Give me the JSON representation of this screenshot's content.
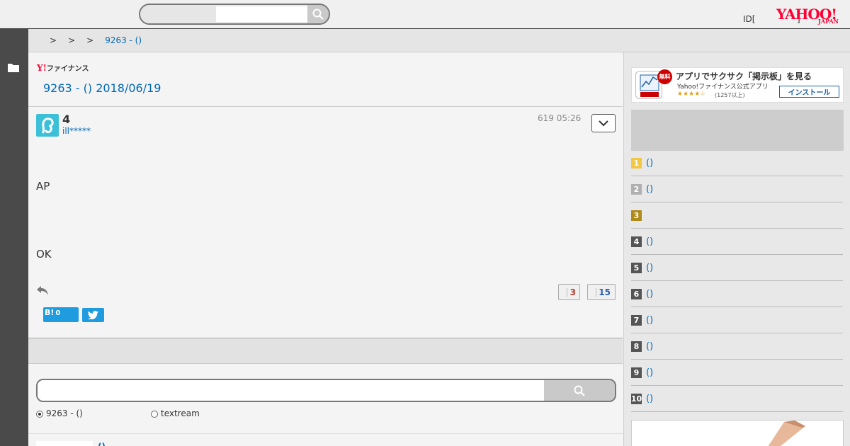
{
  "header": {
    "search_value": "",
    "login_label": "ID[",
    "login_bracket": "]",
    "logo_word": "YAHOO!",
    "logo_sub": "JAPAN"
  },
  "breadcrumb": {
    "separators": [
      ">",
      ">",
      ">"
    ],
    "current": "9263 - ()"
  },
  "board": {
    "logo_mark": "Y!",
    "logo_text": "ファイナンス",
    "title": "9263 - () 2018/06/19"
  },
  "post": {
    "number": "4",
    "user": "ill*****",
    "time": "619 05:26",
    "body_line1": "AP",
    "body_line2": "OK",
    "likes": "3",
    "dislikes": "15",
    "hatena_label": "B!",
    "hatena_count": "0"
  },
  "search_panel": {
    "value": "",
    "radio_options": [
      {
        "label": "9263 - ()",
        "checked": true
      },
      {
        "label": "textream",
        "checked": false
      }
    ]
  },
  "next_item": {
    "link_partial": "()"
  },
  "sidebar": {
    "app_banner": {
      "free_badge": "無料",
      "title": "アプリでサクサク「掲示板」を見る",
      "subtitle": "Yahoo!ファイナンス公式アプリ",
      "stars": "★★★★☆",
      "reviews": "(1257以上)",
      "install_label": "インストール"
    },
    "ranking": [
      {
        "rank": "1",
        "label": "()",
        "color": "#f2c744"
      },
      {
        "rank": "2",
        "label": "()",
        "color": "#b0b0b0"
      },
      {
        "rank": "3",
        "label": "",
        "color": "#b08a1a"
      },
      {
        "rank": "4",
        "label": "()",
        "color": "#555555"
      },
      {
        "rank": "5",
        "label": "()",
        "color": "#555555"
      },
      {
        "rank": "6",
        "label": "()",
        "color": "#555555"
      },
      {
        "rank": "7",
        "label": "()",
        "color": "#555555"
      },
      {
        "rank": "8",
        "label": "()",
        "color": "#555555"
      },
      {
        "rank": "9",
        "label": "()",
        "color": "#555555"
      },
      {
        "rank": "10",
        "label": "()",
        "color": "#555555"
      }
    ]
  },
  "colors": {
    "link": "#0068b7",
    "brand": "#ff0033",
    "share": "#1f9be0"
  }
}
